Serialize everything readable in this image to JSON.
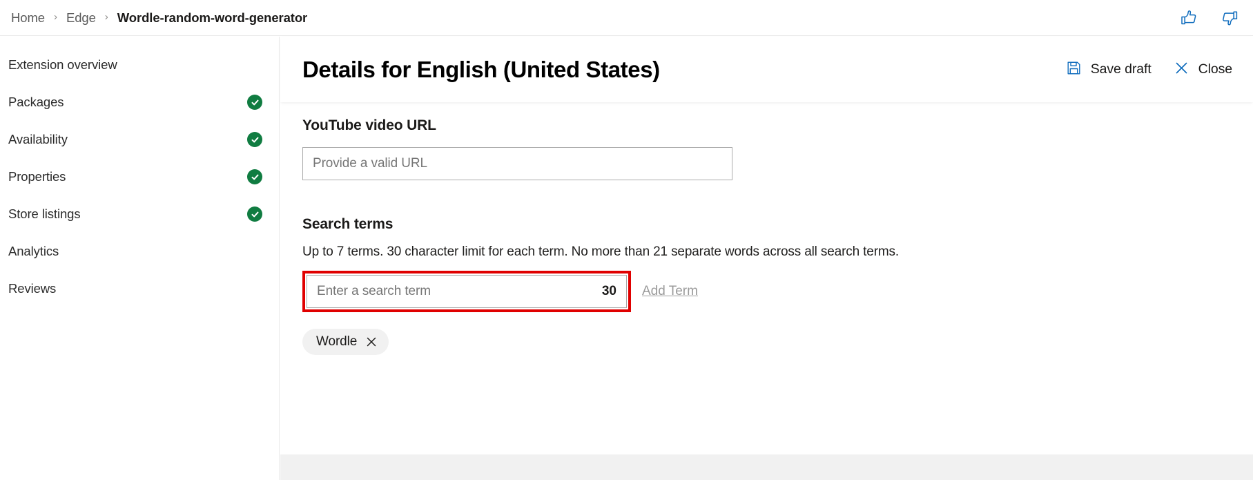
{
  "topbar": {
    "breadcrumb": [
      {
        "label": "Home",
        "current": false
      },
      {
        "label": "Edge",
        "current": false
      },
      {
        "label": "Wordle-random-word-generator",
        "current": true
      }
    ],
    "separator": "›",
    "feedback": {
      "like_icon": "thumbs-up-icon",
      "dislike_icon": "thumbs-down-icon",
      "icon_color": "#0f6cbd"
    }
  },
  "sidebar": {
    "items": [
      {
        "label": "Extension overview",
        "complete": false
      },
      {
        "label": "Packages",
        "complete": true
      },
      {
        "label": "Availability",
        "complete": true
      },
      {
        "label": "Properties",
        "complete": true
      },
      {
        "label": "Store listings",
        "complete": true
      },
      {
        "label": "Analytics",
        "complete": false
      },
      {
        "label": "Reviews",
        "complete": false
      }
    ],
    "check_color": "#107c41",
    "check_icon": "check-circle-icon"
  },
  "main": {
    "title": "Details for English (United States)",
    "actions": {
      "save_label": "Save draft",
      "save_icon": "save-floppy-icon",
      "close_label": "Close",
      "close_icon": "close-x-icon",
      "icon_color": "#0f6cbd"
    },
    "youtube": {
      "label": "YouTube video URL",
      "value": "",
      "placeholder": "Provide a valid URL"
    },
    "search_terms": {
      "label": "Search terms",
      "description": "Up to 7 terms. 30 character limit for each term. No more than 21 separate words across all search terms.",
      "input": {
        "value": "",
        "placeholder": "Enter a search term",
        "char_count": "30",
        "highlight_color": "#e00000"
      },
      "add_button_label": "Add Term",
      "chips": [
        {
          "label": "Wordle",
          "remove_icon": "close-x-icon"
        }
      ]
    }
  }
}
